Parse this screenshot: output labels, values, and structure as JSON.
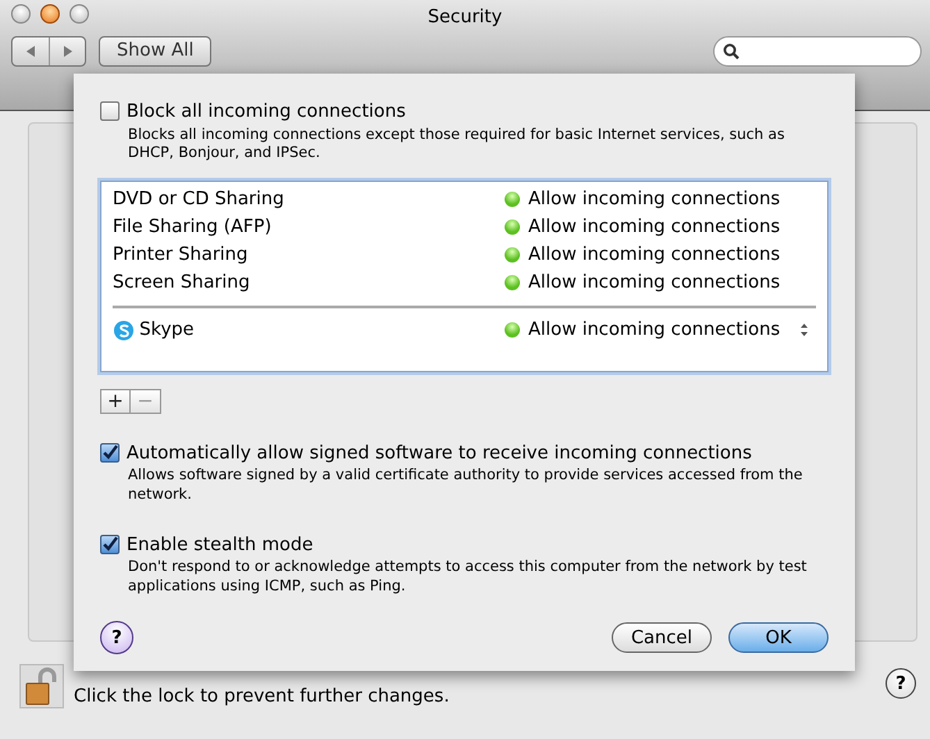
{
  "window": {
    "title": "Security"
  },
  "toolbar": {
    "show_all": "Show All"
  },
  "sheet": {
    "block_all": {
      "label": "Block all incoming connections",
      "description": "Blocks all incoming connections except those required for basic Internet services, such as DHCP, Bonjour, and IPSec.",
      "checked": false
    },
    "entries": [
      {
        "kind": "service",
        "name": "DVD or CD Sharing",
        "status": "Allow incoming connections",
        "color": "#5cc021"
      },
      {
        "kind": "service",
        "name": "File Sharing (AFP)",
        "status": "Allow incoming connections",
        "color": "#5cc021"
      },
      {
        "kind": "service",
        "name": "Printer Sharing",
        "status": "Allow incoming connections",
        "color": "#5cc021"
      },
      {
        "kind": "service",
        "name": "Screen Sharing",
        "status": "Allow incoming connections",
        "color": "#5cc021"
      },
      {
        "kind": "app",
        "name": "Skype",
        "status": "Allow incoming connections",
        "color": "#5cc021"
      }
    ],
    "add": "+",
    "remove": "−",
    "options": [
      {
        "label": "Automatically allow signed software to receive incoming connections",
        "description": "Allows software signed by a valid certificate authority to provide services accessed from the network.",
        "checked": true
      },
      {
        "label": "Enable stealth mode",
        "description": "Don't respond to or acknowledge attempts to access this computer from the network by test applications using ICMP, such as Ping.",
        "checked": true
      }
    ],
    "help": "?",
    "buttons": [
      {
        "label": "Cancel",
        "default": false
      },
      {
        "label": "OK",
        "default": true
      }
    ]
  },
  "footer": {
    "lock_text": "Click the lock to prevent further changes.",
    "help": "?"
  }
}
